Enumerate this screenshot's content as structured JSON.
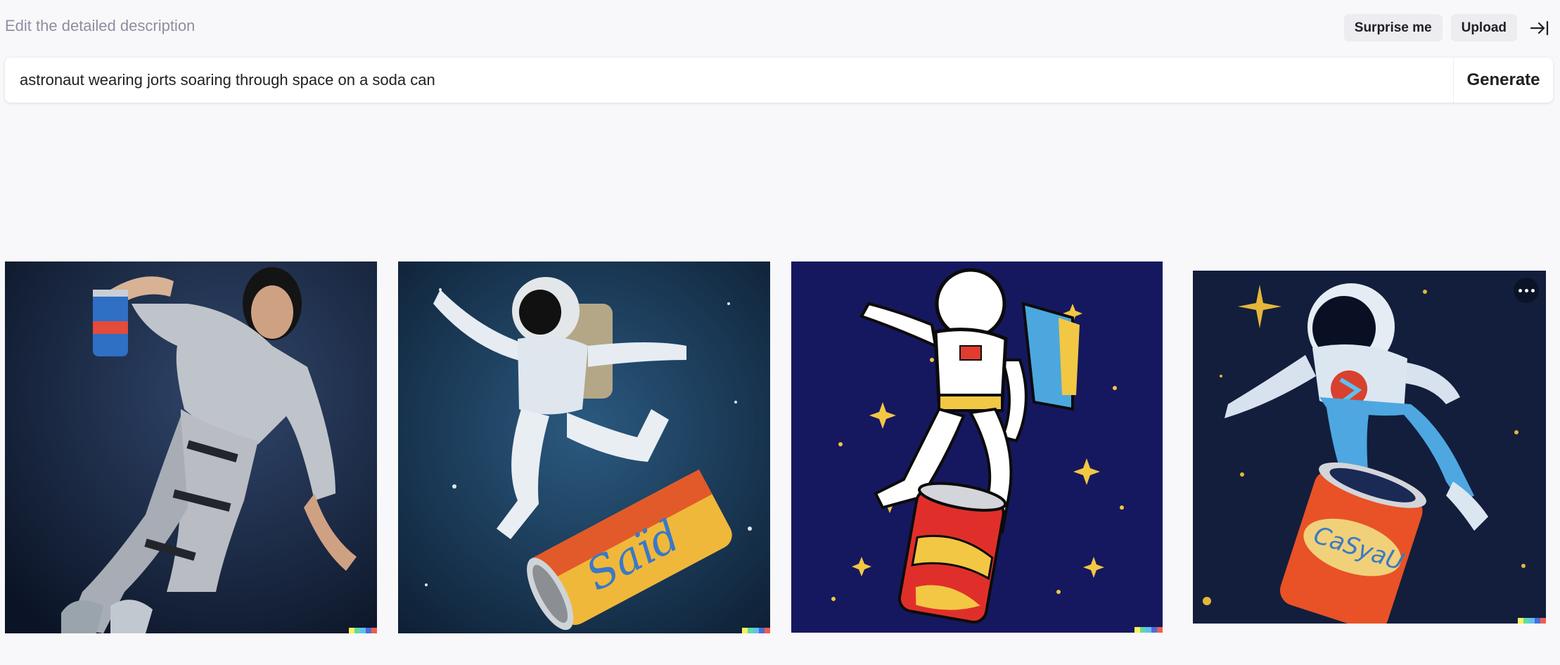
{
  "header": {
    "hint": "Edit the detailed description",
    "surprise_label": "Surprise me",
    "upload_label": "Upload"
  },
  "prompt": {
    "value": "astronaut wearing jorts soaring through space on a soda can",
    "generate_label": "Generate"
  },
  "images": [
    {
      "subject": "woman in silver leg armor holding soda can",
      "background": "#1b2a46"
    },
    {
      "subject": "astronaut riding yellow soda can",
      "background": "#14304d"
    },
    {
      "subject": "cartoon astronaut on red soda can with stars",
      "background": "#15185e"
    },
    {
      "subject": "painted astronaut on orange soda can",
      "background": "#121e3c"
    }
  ],
  "colors": {
    "page_bg": "#f8f8fa",
    "button_bg": "#ececf1",
    "hint_text": "#8e8ea0",
    "signature": [
      "#fdf05f",
      "#61d9a3",
      "#5fc0ef",
      "#4d6bd9",
      "#ec5f4d"
    ]
  },
  "icons": {
    "collapse": "arrow-right-to-bar-icon",
    "more": "ellipsis-icon"
  }
}
